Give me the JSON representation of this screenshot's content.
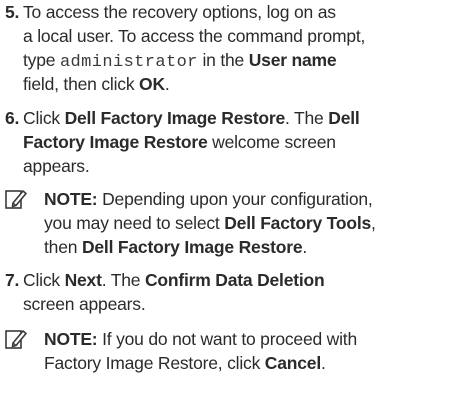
{
  "steps": [
    {
      "number": "5.",
      "lines": [
        [
          {
            "t": "To access the recovery options, log on as",
            "s": ""
          }
        ],
        [
          {
            "t": "a local user. To access the command prompt,",
            "s": ""
          }
        ],
        [
          {
            "t": "type ",
            "s": ""
          },
          {
            "t": "administrator",
            "s": "mono"
          },
          {
            "t": " in the ",
            "s": ""
          },
          {
            "t": "User name",
            "s": "b"
          }
        ],
        [
          {
            "t": "field, then click ",
            "s": ""
          },
          {
            "t": "OK",
            "s": "b"
          },
          {
            "t": ".",
            "s": ""
          }
        ]
      ]
    },
    {
      "number": "6.",
      "lines": [
        [
          {
            "t": "Click ",
            "s": ""
          },
          {
            "t": "Dell Factory Image Restore",
            "s": "b"
          },
          {
            "t": ". The ",
            "s": ""
          },
          {
            "t": "Dell",
            "s": "b"
          }
        ],
        [
          {
            "t": "Factory Image Restore",
            "s": "b"
          },
          {
            "t": " welcome screen",
            "s": ""
          }
        ],
        [
          {
            "t": "appears.",
            "s": ""
          }
        ]
      ]
    },
    {
      "number": "7.",
      "lines": [
        [
          {
            "t": "Click ",
            "s": ""
          },
          {
            "t": "Next",
            "s": "b"
          },
          {
            "t": ". The ",
            "s": ""
          },
          {
            "t": "Confirm Data Deletion",
            "s": "b"
          }
        ],
        [
          {
            "t": "screen appears.",
            "s": ""
          }
        ]
      ]
    }
  ],
  "notes": [
    {
      "icon": "note-pencil-icon",
      "lines": [
        [
          {
            "t": "NOTE:",
            "s": "b"
          },
          {
            "t": " Depending upon your configuration,",
            "s": ""
          }
        ],
        [
          {
            "t": "you may need to select ",
            "s": ""
          },
          {
            "t": "Dell Factory Tools",
            "s": "b"
          },
          {
            "t": ",",
            "s": ""
          }
        ],
        [
          {
            "t": "then ",
            "s": ""
          },
          {
            "t": "Dell Factory Image Restore",
            "s": "b"
          },
          {
            "t": ".",
            "s": ""
          }
        ]
      ]
    },
    {
      "icon": "note-pencil-icon",
      "lines": [
        [
          {
            "t": "NOTE:",
            "s": "b"
          },
          {
            "t": " If you do not want to proceed with",
            "s": ""
          }
        ],
        [
          {
            "t": "Factory Image Restore, click ",
            "s": ""
          },
          {
            "t": "Cancel",
            "s": "b"
          },
          {
            "t": ".",
            "s": ""
          }
        ]
      ]
    }
  ]
}
